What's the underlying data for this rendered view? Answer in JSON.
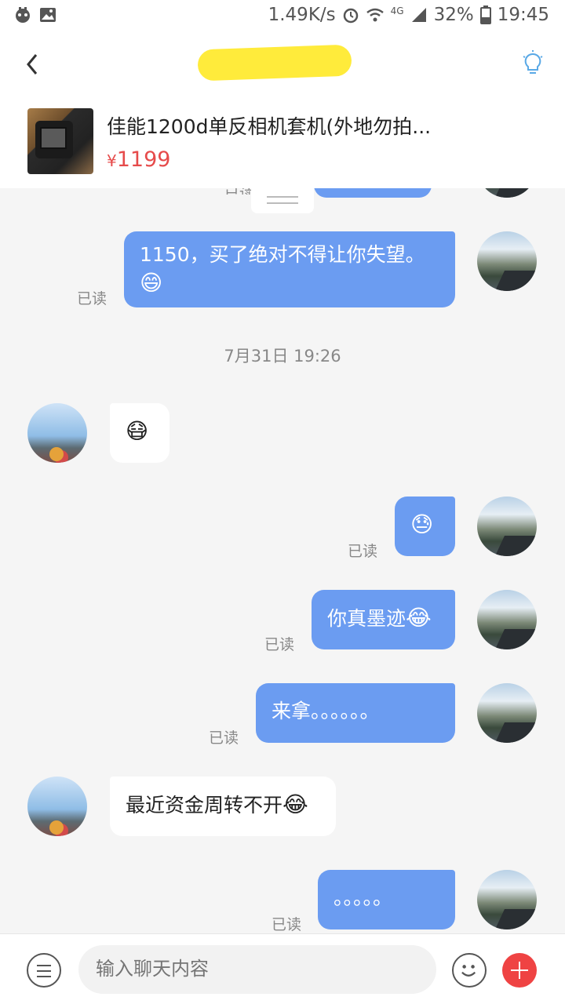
{
  "status_bar": {
    "speed": "1.49K/s",
    "network": "4G",
    "battery": "32%",
    "time": "19:45"
  },
  "header": {
    "title": ""
  },
  "product": {
    "title": "佳能1200d单反相机套机(外地勿拍...",
    "currency": "¥",
    "price": "1199"
  },
  "messages": {
    "m1": {
      "text": "1150，买了绝对不得让你失望。",
      "emoji": "😄",
      "read": "已读"
    },
    "timestamp": "7月31日 19:26",
    "m2": {
      "emoji": "😷"
    },
    "m3": {
      "emoji": "😓",
      "read": "已读"
    },
    "m4": {
      "text": "你真墨迹",
      "emoji": "😂",
      "read": "已读"
    },
    "m5": {
      "text": "来拿。。。。。。",
      "read": "已读"
    },
    "m6": {
      "text": "最近资金周转不开",
      "emoji": "😂"
    },
    "m7": {
      "text": "。。。。。",
      "read": "已读"
    },
    "top_read": "已读"
  },
  "input_bar": {
    "placeholder": "输入聊天内容"
  },
  "colors": {
    "bubble_mine": "#6b9cf1",
    "price": "#e64b4b",
    "plus": "#ef4343",
    "bulb": "#5aa9e6"
  }
}
